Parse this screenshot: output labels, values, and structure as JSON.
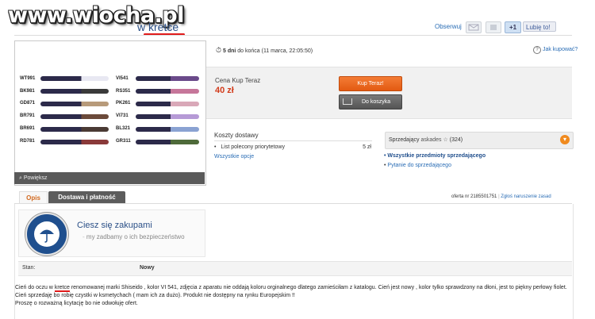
{
  "watermark": "www.wiocha.pl",
  "header": {
    "title_fragment_prefix": "w",
    "title_fragment_keyword": "kretce",
    "observe_label": "Obserwuj",
    "gplus_label": "+1",
    "fb_like_label": "Lubię to!"
  },
  "product_image": {
    "zoom_label": "Powiększ",
    "shades_left": [
      "WT991",
      "BK981",
      "GD871",
      "BR791",
      "BR691",
      "RD781"
    ],
    "shades_right": [
      "VI541",
      "RS351",
      "PK261",
      "VI731",
      "BL321",
      "GR311"
    ]
  },
  "auction": {
    "time_left_bold": "5 dni",
    "time_left_rest": "do końca (11 marca, 22:05:50)",
    "how_to_buy": "Jak kupować?",
    "price_label": "Cena Kup Teraz",
    "price_value": "40 zł",
    "buy_now_label": "Kup Teraz!",
    "cart_label": "Do koszyka"
  },
  "shipping": {
    "title": "Koszty dostawy",
    "item_label": "List polecony priorytetowy",
    "item_price": "5 zł",
    "all_options": "Wszystkie opcje"
  },
  "seller": {
    "label": "Sprzedający",
    "name": "askades",
    "rating": "(324)",
    "all_items_link": "Wszystkie przedmioty sprzedającego",
    "ask_link": "Pytanie do sprzedającego"
  },
  "tabs": {
    "description": "Opis",
    "delivery_payment": "Dostawa i płatność",
    "offer_number": "oferta nr 2185501751",
    "report": "Zgłoś naruszenie zasad"
  },
  "badge": {
    "ring_text": "PROGRAM OCHRONY KUPUJĄCYCH",
    "heading": "Ciesz się zakupami",
    "subheading": "my zadbamy o ich bezpieczeństwo"
  },
  "condition": {
    "label": "Stan:",
    "value": "Nowy"
  },
  "description": {
    "p1_before": "Cień do oczu w ",
    "p1_keyword": "kretce",
    "p1_after": " renomowanej marki Shiseido , kolor VI 541, zdjęcia z aparatu nie oddają koloru orginalnego dlatego zamieściłam z katalogu. Cień jest nowy , kolor tylko sprawdzony na dłoni, jest to piękny perłowy fiolet.",
    "p2": "Cień sprzedaję bo robię czystki w ksmetychach ( mam ich za dużo). Produkt nie dostępny na rynku Europejskim !!",
    "p3": "Proszę o rozważną licytację bo nie odwołuję ofert."
  }
}
